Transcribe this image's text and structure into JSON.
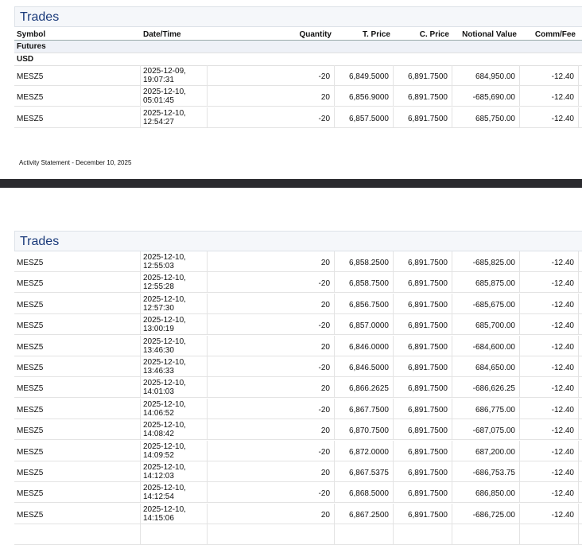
{
  "section_title": "Trades",
  "columns": [
    "Symbol",
    "Date/Time",
    "Quantity",
    "T. Price",
    "C. Price",
    "Notional Value",
    "Comm/Fee"
  ],
  "asset_class": "Futures",
  "currency": "USD",
  "footer": "Activity Statement - December 10, 2025",
  "page1_rows": [
    {
      "symbol": "MESZ5",
      "date": "2025-12-09,",
      "time": "19:07:31",
      "qty": "-20",
      "tprice": "6,849.5000",
      "cprice": "6,891.7500",
      "notional": "684,950.00",
      "comm": "-12.40"
    },
    {
      "symbol": "MESZ5",
      "date": "2025-12-10,",
      "time": "05:01:45",
      "qty": "20",
      "tprice": "6,856.9000",
      "cprice": "6,891.7500",
      "notional": "-685,690.00",
      "comm": "-12.40"
    },
    {
      "symbol": "MESZ5",
      "date": "2025-12-10,",
      "time": "12:54:27",
      "qty": "-20",
      "tprice": "6,857.5000",
      "cprice": "6,891.7500",
      "notional": "685,750.00",
      "comm": "-12.40"
    }
  ],
  "page2_rows": [
    {
      "symbol": "MESZ5",
      "date": "2025-12-10,",
      "time": "12:55:03",
      "qty": "20",
      "tprice": "6,858.2500",
      "cprice": "6,891.7500",
      "notional": "-685,825.00",
      "comm": "-12.40"
    },
    {
      "symbol": "MESZ5",
      "date": "2025-12-10,",
      "time": "12:55:28",
      "qty": "-20",
      "tprice": "6,858.7500",
      "cprice": "6,891.7500",
      "notional": "685,875.00",
      "comm": "-12.40"
    },
    {
      "symbol": "MESZ5",
      "date": "2025-12-10,",
      "time": "12:57:30",
      "qty": "20",
      "tprice": "6,856.7500",
      "cprice": "6,891.7500",
      "notional": "-685,675.00",
      "comm": "-12.40"
    },
    {
      "symbol": "MESZ5",
      "date": "2025-12-10,",
      "time": "13:00:19",
      "qty": "-20",
      "tprice": "6,857.0000",
      "cprice": "6,891.7500",
      "notional": "685,700.00",
      "comm": "-12.40"
    },
    {
      "symbol": "MESZ5",
      "date": "2025-12-10,",
      "time": "13:46:30",
      "qty": "20",
      "tprice": "6,846.0000",
      "cprice": "6,891.7500",
      "notional": "-684,600.00",
      "comm": "-12.40"
    },
    {
      "symbol": "MESZ5",
      "date": "2025-12-10,",
      "time": "13:46:33",
      "qty": "-20",
      "tprice": "6,846.5000",
      "cprice": "6,891.7500",
      "notional": "684,650.00",
      "comm": "-12.40"
    },
    {
      "symbol": "MESZ5",
      "date": "2025-12-10,",
      "time": "14:01:03",
      "qty": "20",
      "tprice": "6,866.2625",
      "cprice": "6,891.7500",
      "notional": "-686,626.25",
      "comm": "-12.40"
    },
    {
      "symbol": "MESZ5",
      "date": "2025-12-10,",
      "time": "14:06:52",
      "qty": "-20",
      "tprice": "6,867.7500",
      "cprice": "6,891.7500",
      "notional": "686,775.00",
      "comm": "-12.40"
    },
    {
      "symbol": "MESZ5",
      "date": "2025-12-10,",
      "time": "14:08:42",
      "qty": "20",
      "tprice": "6,870.7500",
      "cprice": "6,891.7500",
      "notional": "-687,075.00",
      "comm": "-12.40"
    },
    {
      "symbol": "MESZ5",
      "date": "2025-12-10,",
      "time": "14:09:52",
      "qty": "-20",
      "tprice": "6,872.0000",
      "cprice": "6,891.7500",
      "notional": "687,200.00",
      "comm": "-12.40"
    },
    {
      "symbol": "MESZ5",
      "date": "2025-12-10,",
      "time": "14:12:03",
      "qty": "20",
      "tprice": "6,867.5375",
      "cprice": "6,891.7500",
      "notional": "-686,753.75",
      "comm": "-12.40"
    },
    {
      "symbol": "MESZ5",
      "date": "2025-12-10,",
      "time": "14:12:54",
      "qty": "-20",
      "tprice": "6,868.5000",
      "cprice": "6,891.7500",
      "notional": "686,850.00",
      "comm": "-12.40"
    },
    {
      "symbol": "MESZ5",
      "date": "2025-12-10,",
      "time": "14:15:06",
      "qty": "20",
      "tprice": "6,867.2500",
      "cprice": "6,891.7500",
      "notional": "-686,725.00",
      "comm": "-12.40"
    }
  ]
}
